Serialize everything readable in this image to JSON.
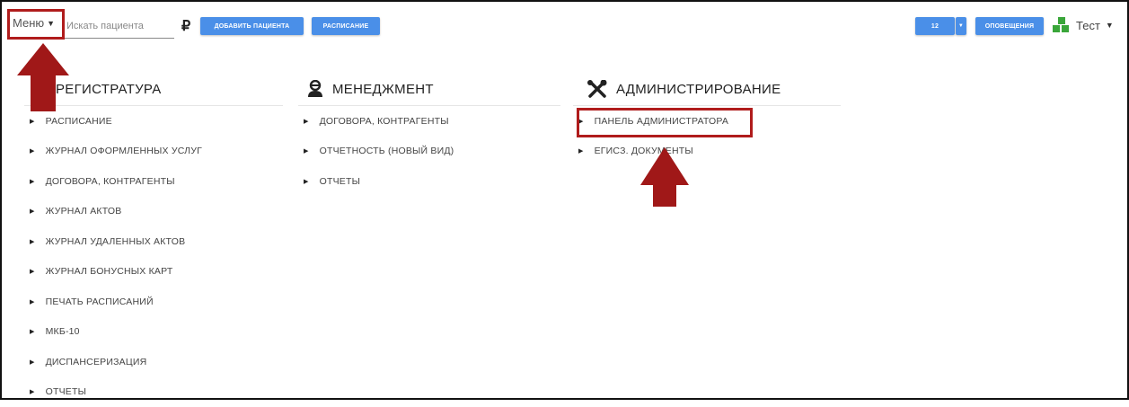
{
  "topbar": {
    "menu_label": "Меню",
    "search_placeholder": "Искать пациента",
    "currency_symbol": "₽",
    "add_patient_label": "ДОБАВИТЬ ПАЦИЕНТА",
    "schedule_label": "РАСПИСАНИЕ",
    "count_label": "12",
    "notifications_label": "ОПОВЕЩЕНИЯ",
    "user_label": "Тест"
  },
  "columns": [
    {
      "title": "РЕГИСТРАТУРА",
      "items": [
        "РАСПИСАНИЕ",
        "ЖУРНАЛ ОФОРМЛЕННЫХ УСЛУГ",
        "ДОГОВОРА, КОНТРАГЕНТЫ",
        "ЖУРНАЛ АКТОВ",
        "ЖУРНАЛ УДАЛЕННЫХ АКТОВ",
        "ЖУРНАЛ БОНУСНЫХ КАРТ",
        "ПЕЧАТЬ РАСПИСАНИЙ",
        "МКБ-10",
        "ДИСПАНСЕРИЗАЦИЯ",
        "ОТЧЕТЫ"
      ]
    },
    {
      "title": "МЕНЕДЖМЕНТ",
      "items": [
        "ДОГОВОРА, КОНТРАГЕНТЫ",
        "ОТЧЕТНОСТЬ (НОВЫЙ ВИД)",
        "ОТЧЕТЫ"
      ]
    },
    {
      "title": "АДМИНИСТРИРОВАНИЕ",
      "items": [
        "ПАНЕЛЬ АДМИНИСТРАТОРА",
        "ЕГИСЗ. ДОКУМЕНТЫ"
      ]
    }
  ],
  "icons": {
    "management": "person-icon",
    "administration": "tools-icon",
    "user": "plant-icon",
    "bullet": "triangle-right-icon"
  },
  "colors": {
    "accent_button": "#4a8fe8",
    "highlight": "#b01c1c",
    "user_icon": "#3aa63a"
  }
}
